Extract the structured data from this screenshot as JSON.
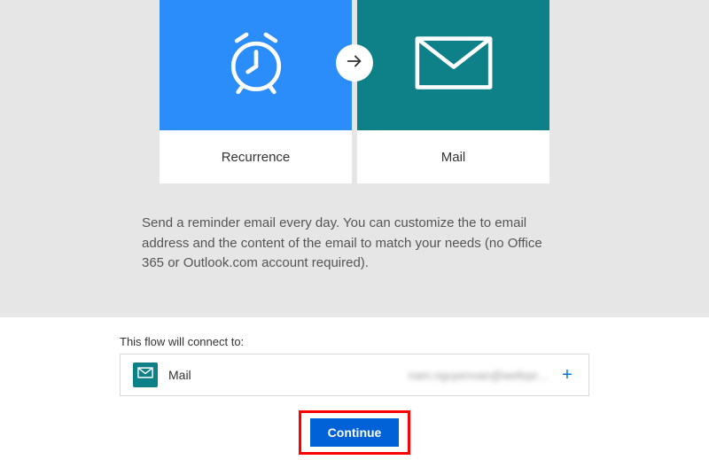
{
  "tiles": {
    "left": {
      "label": "Recurrence",
      "icon": "alarm-clock-icon"
    },
    "right": {
      "label": "Mail",
      "icon": "envelope-icon"
    }
  },
  "description": "Send a reminder email every day. You can customize the to email address and the content of the email to match your needs (no Office 365 or Outlook.com account required).",
  "connect": {
    "heading": "This flow will connect to:",
    "service": "Mail",
    "account": "nam.nguyenvan@wellspr…"
  },
  "continue_label": "Continue",
  "colors": {
    "blue_tile": "#2a8dfa",
    "teal_tile": "#0e8088",
    "primary_button": "#0062d6",
    "highlight": "#ff0000"
  }
}
